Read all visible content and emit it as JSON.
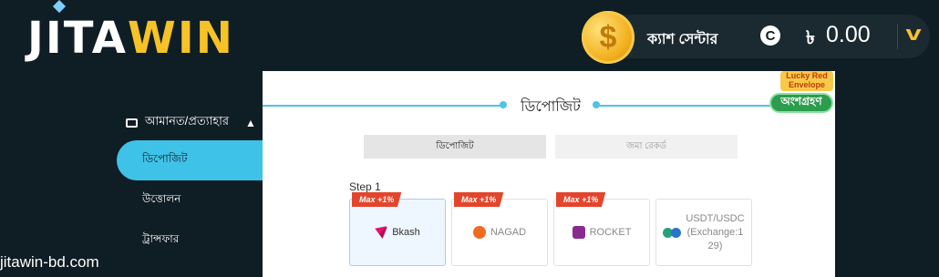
{
  "brand": {
    "logo_part1": "JITA",
    "logo_part2": "WIN"
  },
  "header": {
    "cash_center": "ক্যাশ সেন্টার",
    "currency_symbol": "৳",
    "balance": "0.00"
  },
  "sidebar": {
    "section_title": "আমানত/প্রত্যাহার",
    "items": [
      {
        "label": "ডিপোজিট",
        "active": true
      },
      {
        "label": "উত্তোলন",
        "active": false
      },
      {
        "label": "ট্রান্সফার",
        "active": false
      }
    ]
  },
  "watermark": "jitawin-bd.com",
  "main": {
    "title": "ডিপোজিট",
    "lucky_envelope": "Lucky Red Envelope",
    "join_button": "অংশগ্রহণ",
    "tabs": [
      {
        "label": "ডিপোজিট",
        "active": true
      },
      {
        "label": "জমা রেকর্ড",
        "active": false
      }
    ],
    "step_label": "Step 1",
    "payment_methods": [
      {
        "name": "Bkash",
        "badge": "Max +1%",
        "icon": "bkash-icon"
      },
      {
        "name": "NAGAD",
        "badge": "Max +1%",
        "icon": "nagad-icon"
      },
      {
        "name": "ROCKET",
        "badge": "Max +1%",
        "icon": "rocket-icon"
      },
      {
        "name": "USDT/USDC (Exchange:129)",
        "line1": "USDT/USDC",
        "line2": "(Exchange:1",
        "line3": "29)",
        "icon": "usdt-usdc-icon"
      }
    ]
  },
  "colors": {
    "accent": "#3fc2e8",
    "gold": "#f6c327",
    "badge": "#e3452c",
    "join": "#2b9d4c"
  }
}
